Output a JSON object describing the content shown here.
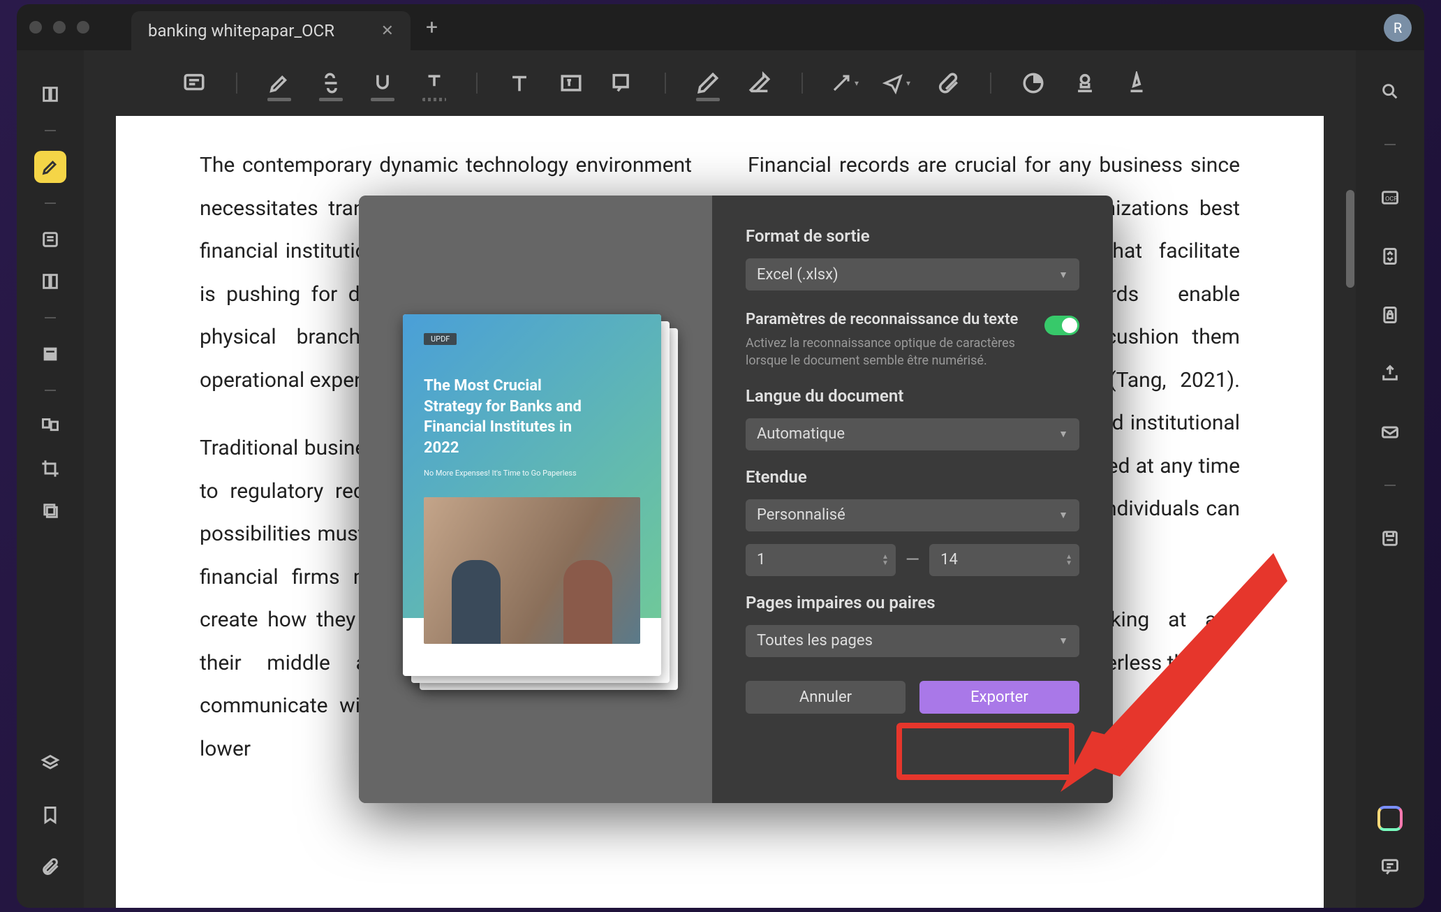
{
  "window": {
    "tab_title": "banking whitepapar_OCR",
    "avatar_letter": "R"
  },
  "document": {
    "left_col_p1": "The contemporary dynamic technology environment necessitates transformation in the way banks and financial institutions function. The banking business is pushing for digital transformation and reducing physical branches and staff numbers to cut operational expenses (Deng et al., 2021).",
    "left_col_p2": "Traditional business models are quickly evolving due to regulatory requirements and new technological possibilities must be prepared for these changes, so financial firms must modernize their systems to create how they connect with consumers, manage their middle and back-office activities, and communicate with them (Cziesla, 2014). It would lower",
    "right_col_p1": "Financial records are crucial for any business since they give a picture of how the organizations best allocate resources and trade-offs that facilitate decision-making. Financial records enable companies to plan effectively and cushion them from unanticipated financial crises (Tang, 2021). Financial records save money, time, and institutional records that ensure they can be retrieved at any time to ensure any potential liabilities and individuals can access them anytime without",
    "right_col_p2": "Commercial banks have been looking at and developing methods for becoming paperless that"
  },
  "modal": {
    "thumb_logo": "UPDF",
    "thumb_title": "The Most Crucial Strategy for Banks and Financial Institutes in 2022",
    "thumb_sub": "No More Expenses! It's Time to Go Paperless",
    "label_format": "Format de sortie",
    "select_format": "Excel (.xlsx)",
    "label_ocr_title": "Paramètres de reconnaissance du texte",
    "label_ocr_desc": "Activez la reconnaissance optique de caractères lorsque le document semble être numérisé.",
    "label_lang": "Langue du document",
    "select_lang": "Automatique",
    "label_range": "Etendue",
    "select_range": "Personnalisé",
    "range_from": "1",
    "range_to": "14",
    "label_oddeven": "Pages impaires ou paires",
    "select_oddeven": "Toutes les pages",
    "btn_cancel": "Annuler",
    "btn_export": "Exporter"
  }
}
